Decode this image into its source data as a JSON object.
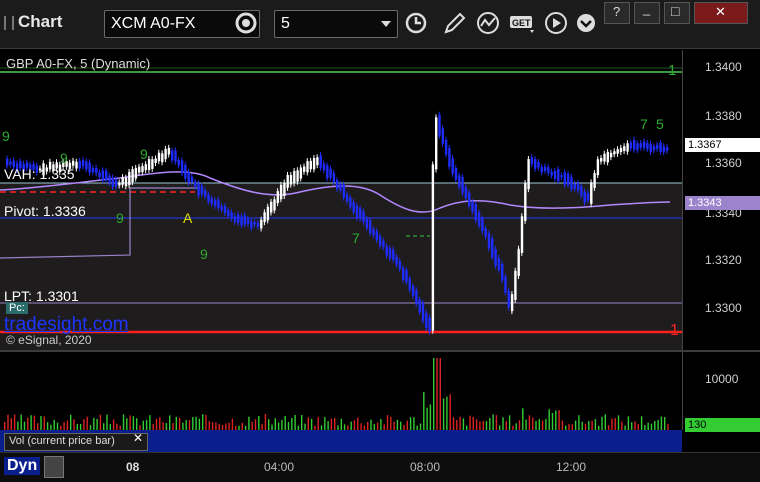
{
  "window": {
    "title": "Chart",
    "symbol": "XCM A0-FX",
    "interval": "5",
    "buttons": {
      "minimize": "_",
      "restore": "□",
      "close": "✕",
      "help": "?"
    }
  },
  "chart": {
    "series_label": "GBP A0-FX, 5 (Dynamic)",
    "pane_label_lpt": "LPT: 1.3301",
    "pane_label_vah": "VAH: 1.335",
    "pane_label_pivot": "Pivot: 1.3336",
    "watermark": "tradesight.com",
    "copyright": "© eSignal, 2020",
    "pc_label": "Pc:",
    "annotation_a": "A",
    "marker_top": "1",
    "marker_bottom": "1",
    "seq_labels": [
      "9",
      "9",
      "9",
      "9",
      "9",
      "7",
      "7",
      "5"
    ],
    "price_axis_ticks": [
      "1.3400",
      "1.3380",
      "1.3360",
      "1.3340",
      "1.3320",
      "1.3300"
    ],
    "price_badges": {
      "last": "1.3367",
      "avg": "1.3343"
    },
    "volume_axis_ticks": [
      "10000"
    ],
    "volume_badge": "130",
    "volume_label": "Vol (current price bar)",
    "vol_close": "✕",
    "time_ticks": [
      "08",
      "04:00",
      "08:00",
      "12:00"
    ],
    "bottom_label": "Dyn",
    "colors": {
      "up": "#ffffff",
      "down": "#1f2cff",
      "avg_line": "#b388ff",
      "red_line": "#ff2020",
      "green_line": "#33aa33",
      "vol_green": "#33cc33",
      "vol_red": "#dd2222"
    }
  }
}
